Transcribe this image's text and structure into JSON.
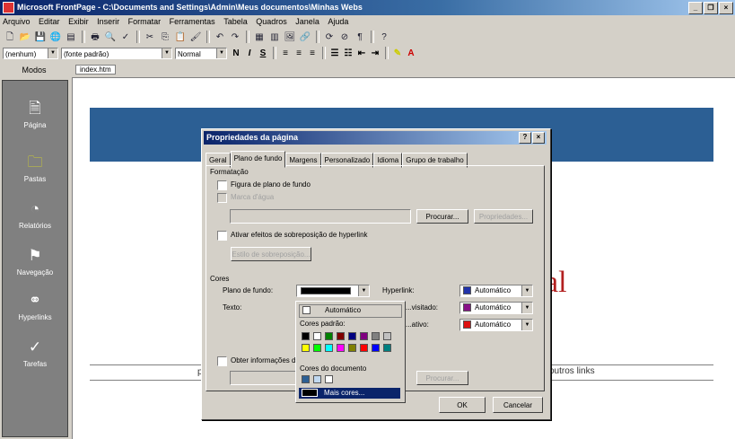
{
  "window": {
    "title": "Microsoft FrontPage - C:\\Documents and Settings\\Admin\\Meus documentos\\Minhas Webs"
  },
  "menu": [
    "Arquivo",
    "Editar",
    "Exibir",
    "Inserir",
    "Formatar",
    "Ferramentas",
    "Tabela",
    "Quadros",
    "Janela",
    "Ajuda"
  ],
  "format_bar": {
    "style": "(nenhum)",
    "font": "(fonte padrão)",
    "size": "Normal"
  },
  "views": {
    "title": "Modos",
    "items": [
      "Página",
      "Pastas",
      "Relatórios",
      "Navegação",
      "Hyperlinks",
      "Tarefas"
    ]
  },
  "document": {
    "tab": "index.htm",
    "partial_title": "al",
    "partial_link": "outros links",
    "partial_left": "p"
  },
  "dialog": {
    "title": "Propriedades da página",
    "tabs": [
      "Geral",
      "Plano de fundo",
      "Margens",
      "Personalizado",
      "Idioma",
      "Grupo de trabalho"
    ],
    "formatting_label": "Formatação",
    "bg_image_label": "Figura de plano de fundo",
    "watermark_label": "Marca d'água",
    "browse": "Procurar...",
    "properties": "Propriedades...",
    "rollover_label": "Ativar efeitos de sobreposição de hyperlink",
    "rollover_style": "Estilo de sobreposição...",
    "colors_label": "Cores",
    "background_label": "Plano de fundo:",
    "text_label": "Texto:",
    "hyperlink_label": "Hyperlink:",
    "visited_label": "...visitado:",
    "active_label": "...ativo:",
    "auto": "Automático",
    "get_info_label": "Obter informações de...",
    "browse2": "Procurar...",
    "ok": "OK",
    "cancel": "Cancelar",
    "swatch_colors": {
      "hyperlink": "#2233aa",
      "visited": "#881188",
      "active": "#dd1111"
    }
  },
  "color_popup": {
    "auto": "Automático",
    "standard_label": "Cores padrão:",
    "document_label": "Cores do documento",
    "more": "Mais cores...",
    "standard_colors": [
      "#000000",
      "#ffffff",
      "#008000",
      "#800000",
      "#000080",
      "#800080",
      "#808080",
      "#c0c0c0",
      "#ffff00",
      "#00ff00",
      "#00ffff",
      "#ff00ff",
      "#808000",
      "#ff0000",
      "#0000ff",
      "#008080"
    ],
    "document_colors": [
      "#2c5f94",
      "#c0d8f0",
      "#ffffff"
    ]
  }
}
